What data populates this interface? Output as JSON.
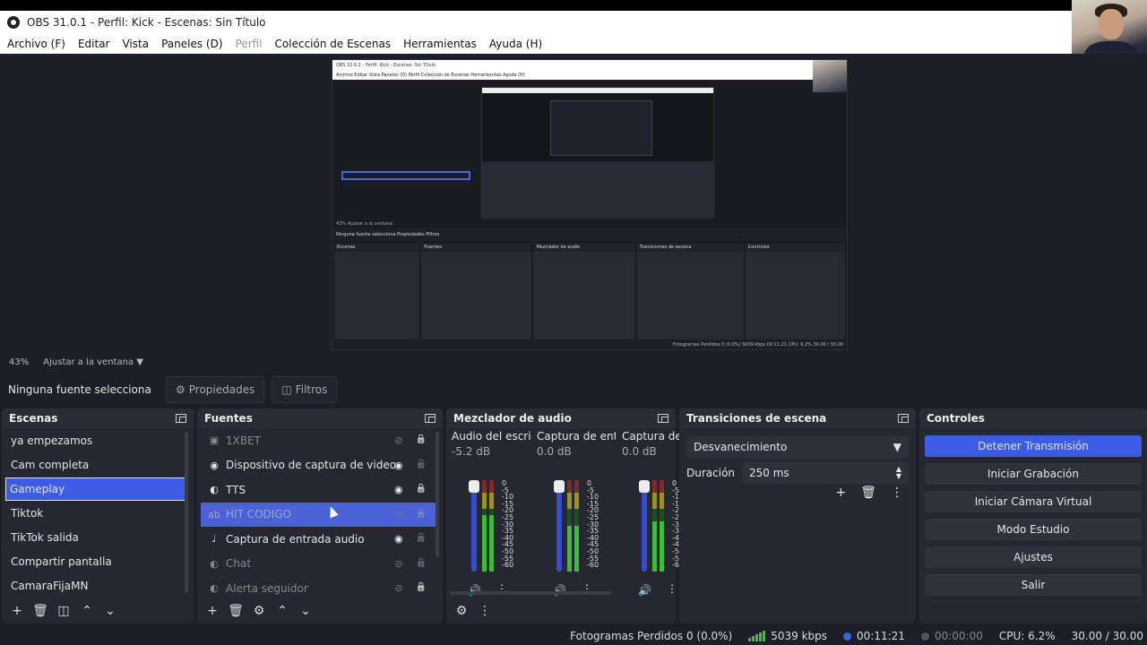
{
  "window": {
    "title": "OBS 31.0.1 - Perfil: Kick - Escenas: Sin Título"
  },
  "menu": [
    {
      "label": "Archivo (F)",
      "disabled": false
    },
    {
      "label": "Editar",
      "disabled": false
    },
    {
      "label": "Vista",
      "disabled": false
    },
    {
      "label": "Paneles (D)",
      "disabled": false
    },
    {
      "label": "Perfil",
      "disabled": true
    },
    {
      "label": "Colección de Escenas",
      "disabled": false
    },
    {
      "label": "Herramientas",
      "disabled": false
    },
    {
      "label": "Ayuda (H)",
      "disabled": false
    }
  ],
  "preview_embedded": {
    "title": "OBS 31.0.1 - Perfil: Kick - Escenas: Sin Título",
    "menu": "Archivo  Editar  Vista  Paneles (D)  Perfil  Colección de Escenas  Herramientas  Ayuda (H)",
    "zoom": "43%  Ajustar a la ventana",
    "source_bar": "Ninguna fuente selecciona     Propiedades     Filtros",
    "docks": [
      "Escenas",
      "Fuentes",
      "Mezclador de audio",
      "Transiciones de escena",
      "Controles"
    ],
    "status": "Fotogramas Perdidos 0 (0.0%)   5039 kbps   00:11:21   CPU: 6.2%   30.00 / 30.00"
  },
  "zoombar": {
    "zoom": "43%",
    "fit": "Ajustar a la ventana"
  },
  "source_bar": {
    "label": "Ninguna fuente selecciona",
    "properties": "Propiedades",
    "filters": "Filtros"
  },
  "scenes": {
    "title": "Escenas",
    "items": [
      {
        "label": "ya empezamos",
        "selected": false
      },
      {
        "label": "Cam completa",
        "selected": false
      },
      {
        "label": "Gameplay",
        "selected": true
      },
      {
        "label": "Tiktok",
        "selected": false
      },
      {
        "label": "TikTok salida",
        "selected": false
      },
      {
        "label": "Compartir pantalla",
        "selected": false
      },
      {
        "label": "CamaraFijaMN",
        "selected": false
      }
    ]
  },
  "sources": {
    "title": "Fuentes",
    "items": [
      {
        "label": "1XBET",
        "icon": "image-icon",
        "visible": false,
        "locked": true,
        "state": "dim"
      },
      {
        "label": "Dispositivo de captura de video",
        "icon": "camera-icon",
        "visible": true,
        "locked": false,
        "state": "normal"
      },
      {
        "label": "TTS",
        "icon": "browser-icon",
        "visible": true,
        "locked": true,
        "state": "normal"
      },
      {
        "label": "HIT CODIGO",
        "icon": "text-icon",
        "visible": false,
        "locked": false,
        "state": "highlight"
      },
      {
        "label": "Captura de entrada audio",
        "icon": "microphone-icon",
        "visible": true,
        "locked": false,
        "state": "normal"
      },
      {
        "label": "Chat",
        "icon": "browser-icon",
        "visible": false,
        "locked": false,
        "state": "dim"
      },
      {
        "label": "Alerta seguidor",
        "icon": "browser-icon",
        "visible": false,
        "locked": true,
        "state": "dim"
      }
    ]
  },
  "mixer": {
    "title": "Mezclador de audio",
    "channels": [
      {
        "name": "Audio del escritorio",
        "db": "-5.2 dB",
        "level": 0.62
      },
      {
        "name": "Captura de entrada audio",
        "db": "0.0 dB",
        "level": 0.5
      },
      {
        "name": "Captura de entrada",
        "db": "0.0 dB",
        "level": 0.55
      }
    ],
    "scale": [
      "0",
      "-5",
      "-10",
      "-15",
      "-20",
      "-25",
      "-30",
      "-35",
      "-40",
      "-45",
      "-50",
      "-55",
      "-60"
    ]
  },
  "transitions": {
    "title": "Transiciones de escena",
    "selected": "Desvanecimiento",
    "duration_label": "Duración",
    "duration_value": "250 ms"
  },
  "controls": {
    "title": "Controles",
    "buttons": [
      "Detener Transmisión",
      "Iniciar Grabación",
      "Iniciar Cámara Virtual",
      "Modo Estudio",
      "Ajustes",
      "Salir"
    ]
  },
  "status": {
    "dropped": "Fotogramas Perdidos 0 (0.0%)",
    "bitrate": "5039 kbps",
    "stream_time": "00:11:21",
    "rec_time": "00:00:00",
    "cpu": "CPU: 6.2%",
    "fps": "30.00 / 30.00"
  },
  "colors": {
    "accent": "#3c5ce6",
    "panel": "#252830",
    "bg": "#1d1f26"
  }
}
